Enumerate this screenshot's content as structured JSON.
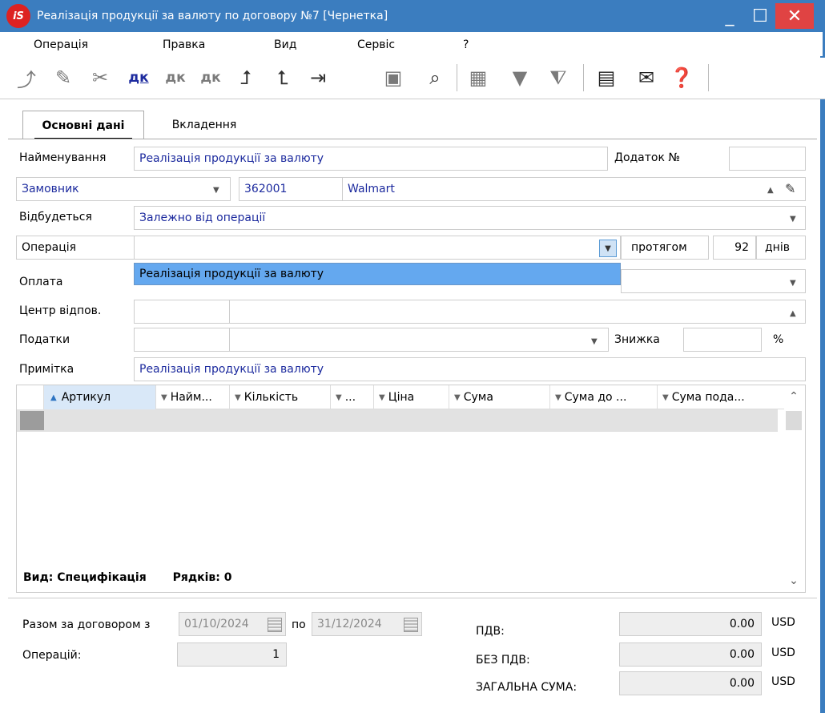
{
  "window": {
    "logo": "iS",
    "title": "Реалізація продукції за валюту по договору №7 [Чернетка]",
    "minimize": "_",
    "maximize": "☐",
    "close": "✕"
  },
  "menu": [
    "Операція",
    "Правка",
    "Вид",
    "Сервіс",
    "?"
  ],
  "toolbar": {
    "icons": [
      "add-doc-icon",
      "edit-doc-icon",
      "delete-doc-icon",
      "debit-credit-icon",
      "debit-credit-copy-icon",
      "debit-credit-delete-icon",
      "move-up-icon",
      "move-down-icon",
      "export-icon",
      "print-icon",
      "search-icon",
      "table-icon",
      "filter-icon",
      "clear-filter-icon",
      "document-icon",
      "mail-icon",
      "help-icon"
    ]
  },
  "tabs": {
    "main": "Основні дані",
    "attachments": "Вкладення"
  },
  "form": {
    "name_label": "Найменування",
    "name_value": "Реалізація продукції за валюту",
    "addendum_label": "Додаток №",
    "addendum_value": "",
    "party_type": "Замовник",
    "party_code": "362001",
    "party_name": "Walmart",
    "occurs_label": "Відбудеться",
    "occurs_value": "Залежно від операції",
    "operation_label": "Операція",
    "operation_value": "",
    "within_label": "протягом",
    "within_value": "92",
    "days_label": "днів",
    "dropdown_option": "Реалізація продукції за валюту",
    "payment_label": "Оплата",
    "center_label": "Центр відпов.",
    "taxes_label": "Податки",
    "discount_label": "Знижка",
    "discount_value": "",
    "percent": "%",
    "note_label": "Примітка",
    "note_value": "Реалізація продукції за валюту"
  },
  "grid": {
    "columns": [
      "Артикул",
      "Найм...",
      "Кількість",
      "...",
      "Ціна",
      "Сума",
      "Сума до ...",
      "Сума пода..."
    ],
    "view_label": "Вид: Специфікація",
    "rows_label": "Рядків: 0"
  },
  "footer": {
    "total_label": "Разом за договором з",
    "date_from": "01/10/2024",
    "to_label": "по",
    "date_to": "31/12/2024",
    "ops_label": "Операцій:",
    "ops_value": "1",
    "vat_label": "ПДВ:",
    "vat_value": "0.00",
    "novat_label": "БЕЗ ПДВ:",
    "novat_value": "0.00",
    "sum_label": "ЗАГАЛЬНА СУМА:",
    "sum_value": "0.00",
    "currency": "USD"
  },
  "colors": {
    "titlebar": "#3b7dbf",
    "close": "#e04343",
    "selection": "#64a8ef",
    "field_text": "#1c2a9e"
  }
}
